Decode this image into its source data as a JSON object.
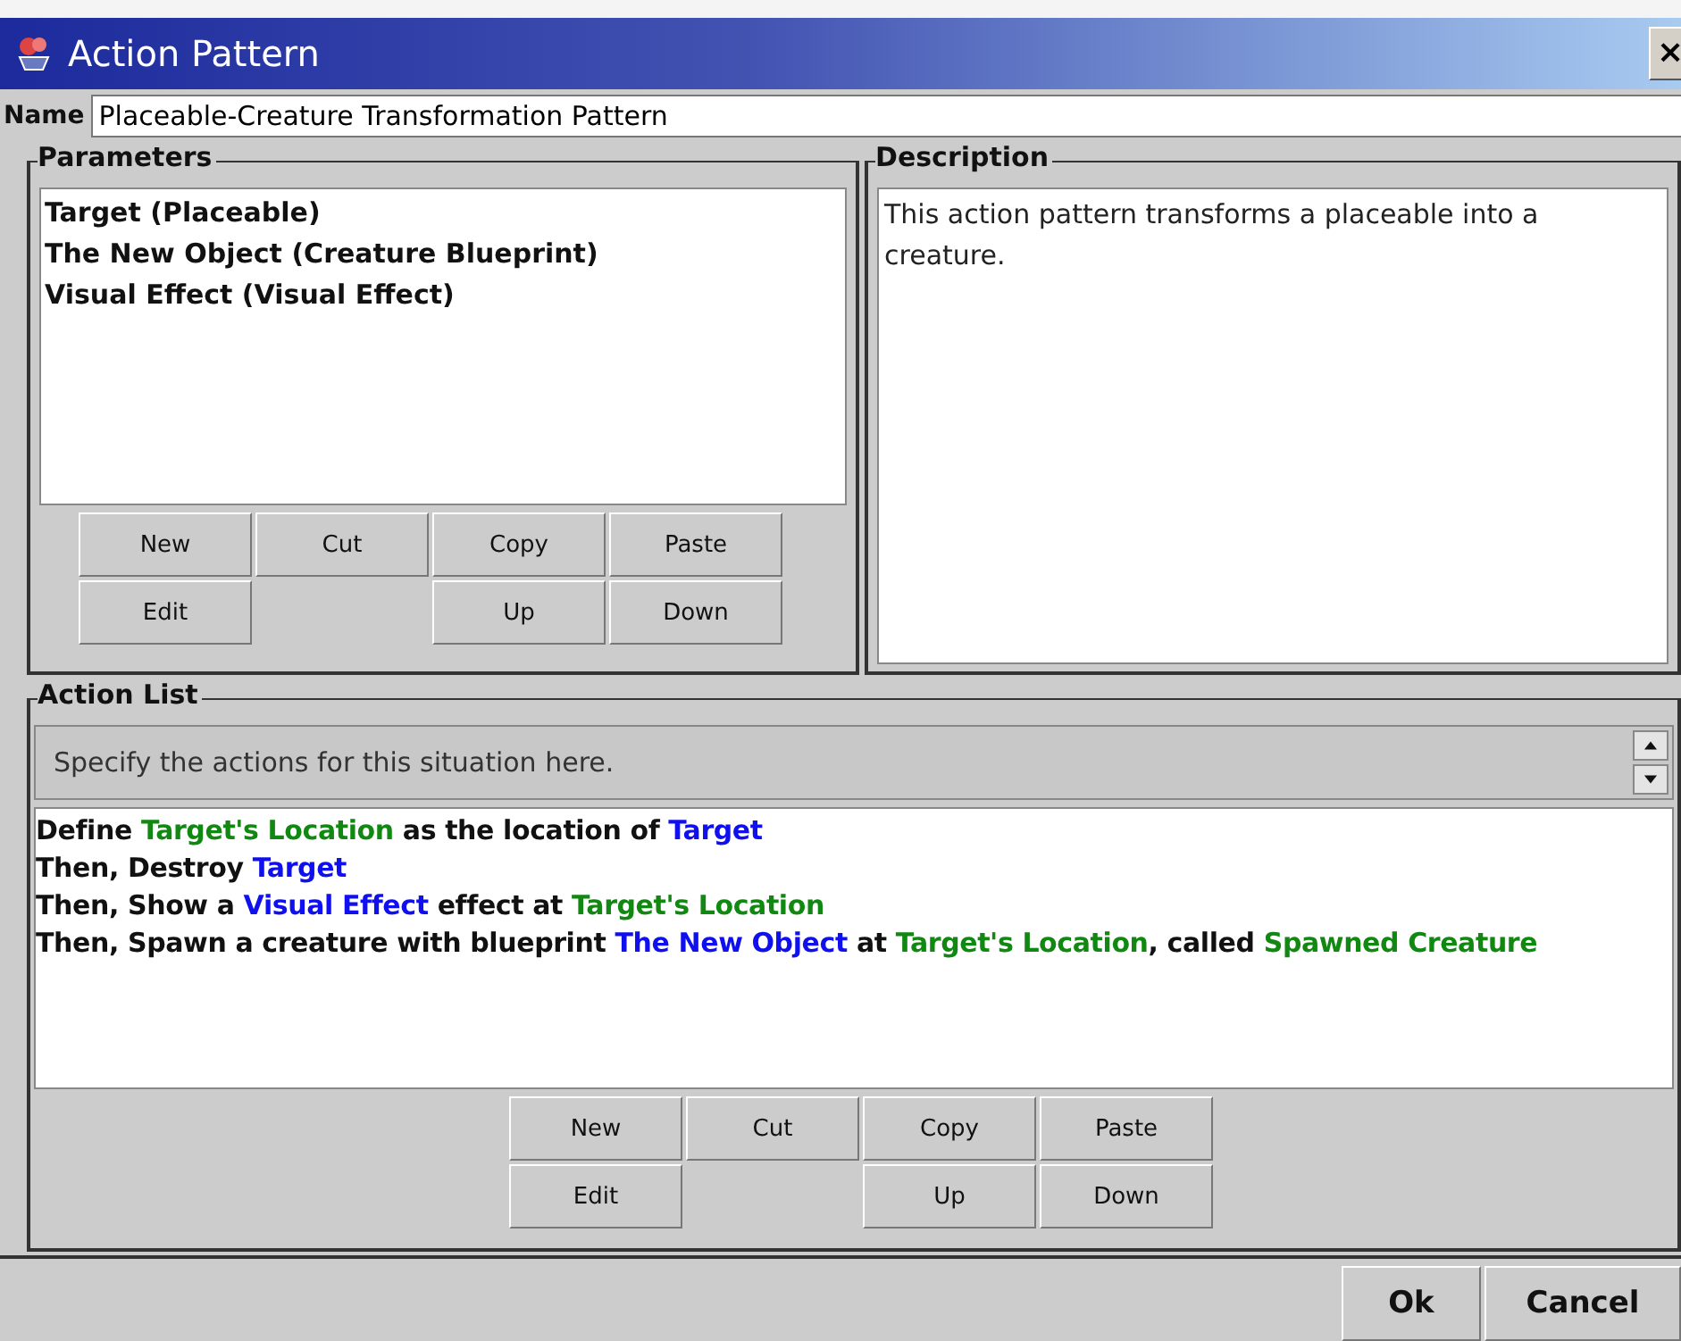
{
  "window": {
    "title": "Action Pattern",
    "close": "×"
  },
  "name_field": {
    "label": "Name",
    "value": "Placeable-Creature Transformation Pattern"
  },
  "parameters": {
    "title": "Parameters",
    "items": [
      "Target (Placeable)",
      "The New Object (Creature Blueprint)",
      "Visual Effect (Visual Effect)"
    ],
    "buttons": [
      {
        "kind": "button",
        "label": "New"
      },
      {
        "kind": "button",
        "label": "Cut"
      },
      {
        "kind": "button",
        "label": "Copy"
      },
      {
        "kind": "button",
        "label": "Paste"
      },
      {
        "kind": "button",
        "label": "Edit"
      },
      {
        "kind": "gap"
      },
      {
        "kind": "button",
        "label": "Up"
      },
      {
        "kind": "button",
        "label": "Down"
      }
    ]
  },
  "description": {
    "title": "Description",
    "text": "This action pattern transforms a placeable into a creature."
  },
  "action_list": {
    "title": "Action List",
    "hint": "Specify the actions for this situation here.",
    "actions": [
      [
        {
          "kind": "plain",
          "text": "Define "
        },
        {
          "kind": "local",
          "text": "Target's Location"
        },
        {
          "kind": "plain",
          "text": " as the location of "
        },
        {
          "kind": "param",
          "text": "Target"
        }
      ],
      [
        {
          "kind": "plain",
          "text": "Then, Destroy "
        },
        {
          "kind": "param",
          "text": "Target"
        }
      ],
      [
        {
          "kind": "plain",
          "text": "Then, Show a "
        },
        {
          "kind": "param",
          "text": "Visual Effect"
        },
        {
          "kind": "plain",
          "text": " effect at "
        },
        {
          "kind": "local",
          "text": "Target's Location"
        }
      ],
      [
        {
          "kind": "plain",
          "text": "Then, Spawn a creature with blueprint "
        },
        {
          "kind": "param",
          "text": "The New Object"
        },
        {
          "kind": "plain",
          "text": " at "
        },
        {
          "kind": "local",
          "text": "Target's Location"
        },
        {
          "kind": "plain",
          "text": ", called "
        },
        {
          "kind": "local",
          "text": "Spawned Creature"
        }
      ]
    ],
    "buttons": [
      {
        "kind": "button",
        "label": "New"
      },
      {
        "kind": "button",
        "label": "Cut"
      },
      {
        "kind": "button",
        "label": "Copy"
      },
      {
        "kind": "button",
        "label": "Paste"
      },
      {
        "kind": "button",
        "label": "Edit"
      },
      {
        "kind": "gap"
      },
      {
        "kind": "button",
        "label": "Up"
      },
      {
        "kind": "button",
        "label": "Down"
      }
    ]
  },
  "dialog_buttons": [
    "Ok",
    "Cancel"
  ]
}
